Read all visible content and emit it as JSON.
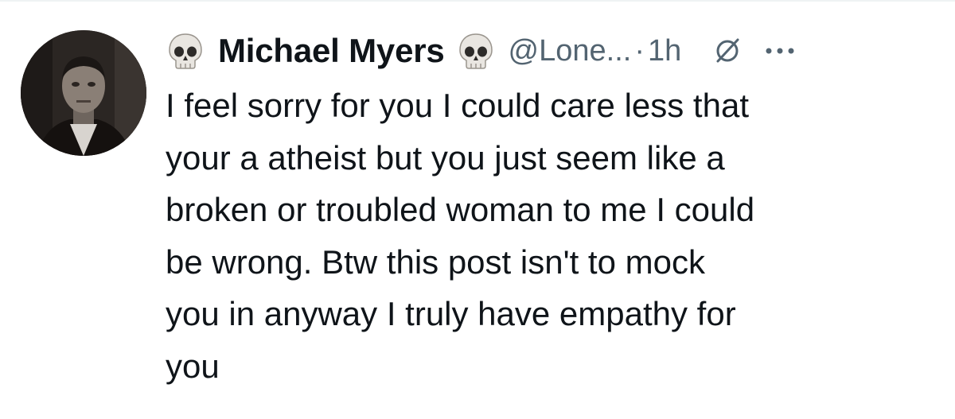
{
  "tweet": {
    "display_name": "Michael Myers",
    "handle": "@Lone...",
    "separator": "·",
    "time": "1h",
    "emoji_left": "skull",
    "emoji_right": "skull",
    "text": "I feel sorry for you I could care less that\nyour a atheist but you just seem like a\nbroken or troubled woman to me I could\nbe wrong.  Btw this post isn't to mock\nyou in anyway I truly have empathy for\nyou"
  },
  "icons": {
    "avatar": "profile-photo",
    "grok": "grok-icon",
    "more": "more-options-icon"
  },
  "colors": {
    "text_primary": "#0f1419",
    "text_secondary": "#536471",
    "divider": "#eff3f4"
  }
}
